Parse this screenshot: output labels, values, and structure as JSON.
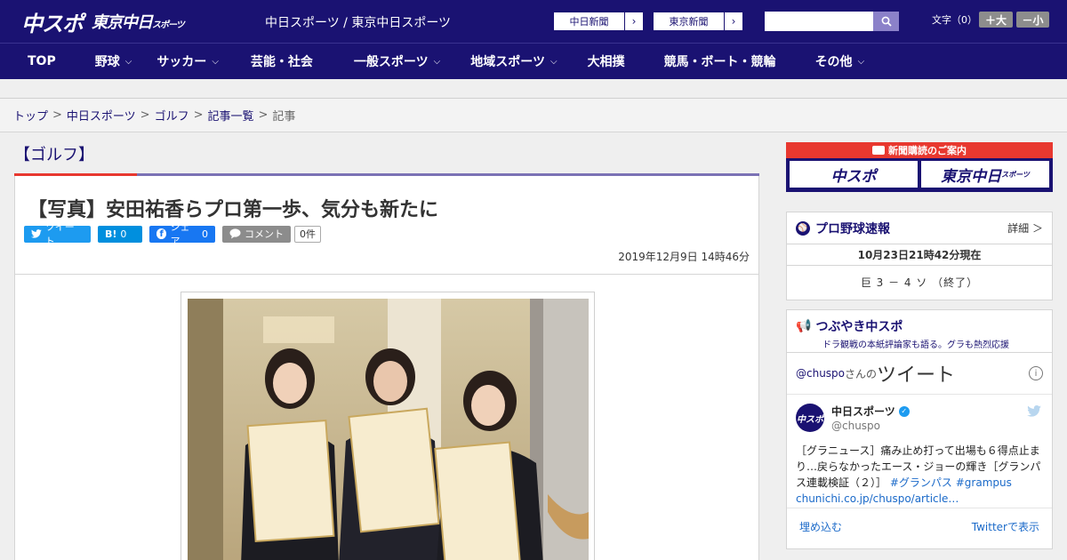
{
  "header": {
    "logo_main": "中スポ",
    "logo_tokyo": "東京中日",
    "logo_tokyo_small": "スポーツ",
    "site_title": "中日スポーツ / 東京中日スポーツ",
    "ext_links": [
      {
        "label": "中日新聞"
      },
      {
        "label": "東京新聞"
      }
    ],
    "search_placeholder": "",
    "fontsize_label": "文字（0）",
    "fontsize_up": "＋大",
    "fontsize_down": "－小"
  },
  "nav": [
    {
      "label": "TOP",
      "dropdown": false
    },
    {
      "label": "野球",
      "dropdown": true
    },
    {
      "label": "サッカー",
      "dropdown": true
    },
    {
      "label": "芸能・社会",
      "dropdown": false
    },
    {
      "label": "一般スポーツ",
      "dropdown": true
    },
    {
      "label": "地域スポーツ",
      "dropdown": true
    },
    {
      "label": "大相撲",
      "dropdown": false
    },
    {
      "label": "競馬・ボート・競輪",
      "dropdown": false
    },
    {
      "label": "その他",
      "dropdown": true
    }
  ],
  "breadcrumb": {
    "items": [
      "トップ",
      "中日スポーツ",
      "ゴルフ",
      "記事一覧"
    ],
    "current": "記事"
  },
  "article": {
    "category": "【ゴルフ】",
    "headline": "【写真】安田祐香らプロ第一歩、気分も新たに",
    "share": {
      "tweet": "ツイート",
      "hatena": "B!",
      "hatena_count": "0",
      "facebook": "シェア",
      "facebook_count": "0",
      "comment": "コメント",
      "comment_count": "0件"
    },
    "date": "2019年12月9日 14時46分"
  },
  "sidebar": {
    "subscribe_title": "新聞購読のご案内",
    "subscribe_logo_1": "中スポ",
    "subscribe_logo_2": "東京中日",
    "subscribe_logo_2_small": "スポーツ",
    "baseball": {
      "title": "プロ野球速報",
      "more": "詳細 ＞",
      "time": "10月23日21時42分現在",
      "score": "巨 3 － 4 ソ （終了）"
    },
    "tsubuyaki": {
      "title": "つぶやき中スポ",
      "subtitle": "ドラ観戦の本紙評論家も語る。グラも熱烈応援",
      "handle": "@chuspo",
      "san": "さんの",
      "big": "ツイート",
      "info": "i",
      "tweet": {
        "avatar": "中スポ",
        "name": "中日スポーツ",
        "username": "@chuspo",
        "text": "［グラニュース］痛み止め打って出場も６得点止まり…戻らなかったエース・ジョーの輝き［グランパス連載検証（２）］",
        "tag1": "#グランパス",
        "tag2": "#grampus",
        "link": "chunichi.co.jp/chuspo/article…"
      },
      "embed": "埋め込む",
      "view_on": "Twitterで表示"
    }
  }
}
